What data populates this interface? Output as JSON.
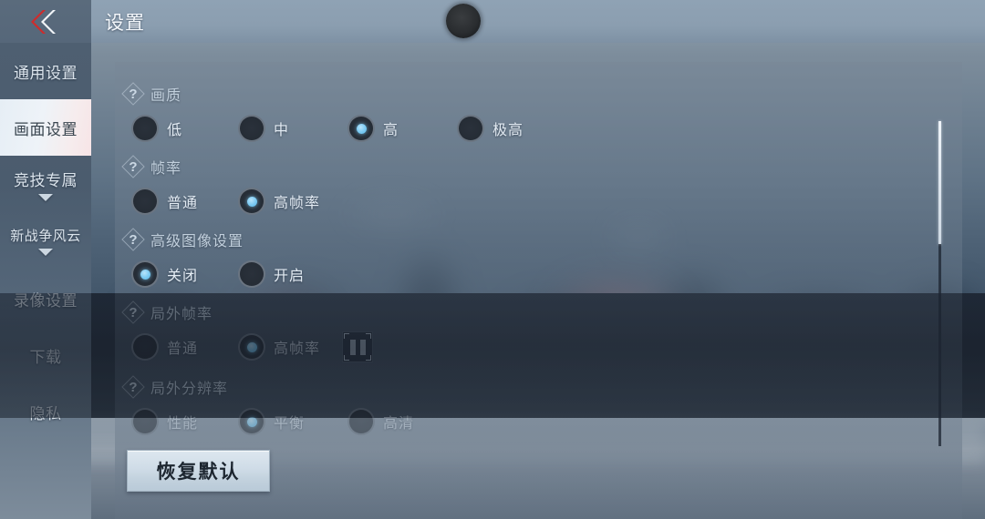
{
  "header": {
    "title": "设置",
    "back_icon": "double-chevron-left-icon",
    "camera_notch": "camera-punch-hole"
  },
  "sidebar": {
    "items": [
      {
        "label": "通用设置",
        "active": false,
        "caret": false
      },
      {
        "label": "画面设置",
        "active": true,
        "caret": false
      },
      {
        "label": "竞技专属",
        "active": false,
        "caret": true
      },
      {
        "label": "新战争风云",
        "active": false,
        "caret": true
      },
      {
        "label": "录像设置",
        "active": false,
        "caret": false
      },
      {
        "label": "下载",
        "active": false,
        "caret": false
      },
      {
        "label": "隐私",
        "active": false,
        "caret": false
      }
    ]
  },
  "settings": {
    "help_icon": "question-mark-diamond-icon",
    "groups": [
      {
        "title": "画质",
        "options": [
          {
            "label": "低",
            "selected": false
          },
          {
            "label": "中",
            "selected": false
          },
          {
            "label": "高",
            "selected": true
          },
          {
            "label": "极高",
            "selected": false
          }
        ]
      },
      {
        "title": "帧率",
        "options": [
          {
            "label": "普通",
            "selected": false
          },
          {
            "label": "高帧率",
            "selected": true
          }
        ]
      },
      {
        "title": "高级图像设置",
        "options": [
          {
            "label": "关闭",
            "selected": true
          },
          {
            "label": "开启",
            "selected": false
          }
        ]
      },
      {
        "title": "局外帧率",
        "options": [
          {
            "label": "普通",
            "selected": false
          },
          {
            "label": "高帧率",
            "selected": true
          }
        ],
        "extra_button": "pause-button"
      },
      {
        "title": "局外分辨率",
        "options": [
          {
            "label": "性能",
            "selected": false
          },
          {
            "label": "平衡",
            "selected": true
          },
          {
            "label": "高清",
            "selected": false
          }
        ]
      }
    ]
  },
  "footer": {
    "reset_label": "恢复默认"
  },
  "scrollbar": {
    "name": "settings-scrollbar"
  },
  "colors": {
    "accent_blue": "#79c9f2",
    "back_red": "#c9302c",
    "panel_overlay": "#7a8896",
    "active_nav_bg": "#eef3f8"
  }
}
